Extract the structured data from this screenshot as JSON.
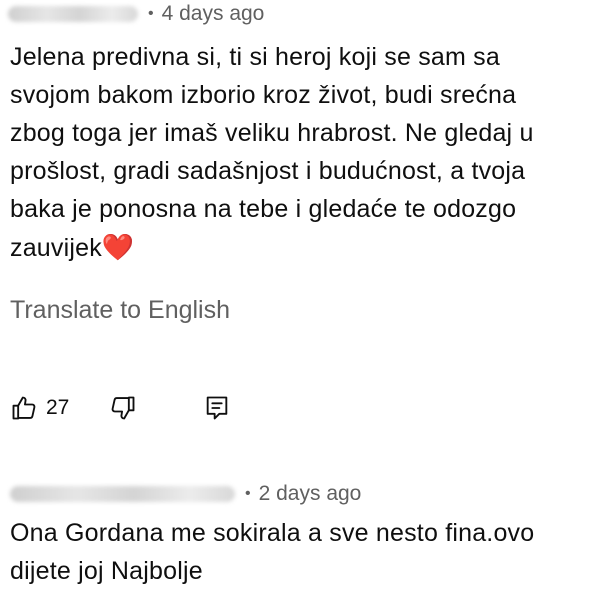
{
  "comments": [
    {
      "time": "4 days ago",
      "lines": [
        "Jelena predivna si, ti si heroj koji se sam sa",
        "svojom bakom izborio kroz život, budi srećna",
        "zbog toga jer imaš veliku hrabrost. Ne gledaj u",
        "prošlost, gradi sadašnjost i budućnost, a tvoja",
        "baka je ponosna na tebe i gledaće te odozgo",
        "zauvijek"
      ],
      "translate_label": "Translate to English",
      "likes": "27"
    },
    {
      "time": "2 days ago",
      "lines": [
        "Ona Gordana me sokirala a sve nesto fina.ovo",
        "dijete joj Najbolje"
      ]
    }
  ],
  "meta_separator": "•",
  "icons": {
    "heart": "heart-emoji",
    "like": "thumbs-up-icon",
    "dislike": "thumbs-down-icon",
    "reply": "reply-icon"
  },
  "colors": {
    "text": "#0f0f0f",
    "secondary": "#606060",
    "heart": "#e0245e"
  }
}
